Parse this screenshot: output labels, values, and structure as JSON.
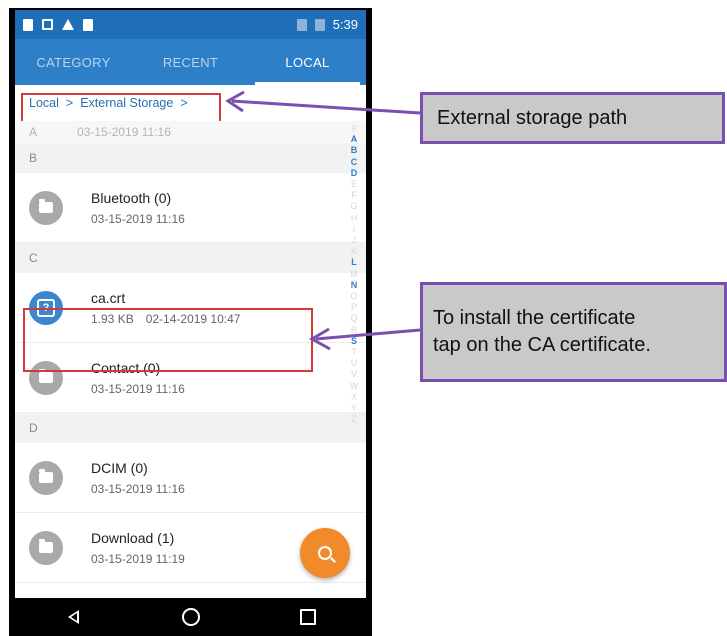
{
  "statusbar": {
    "time": "5:39"
  },
  "tabs": [
    {
      "label": "CATEGORY",
      "active": false
    },
    {
      "label": "RECENT",
      "active": false
    },
    {
      "label": "LOCAL",
      "active": true
    }
  ],
  "breadcrumb": {
    "root": "Local",
    "sep": ">",
    "current": "External Storage",
    "trailing": ">"
  },
  "sections": {
    "a": "A",
    "a_ghost_date": "03-15-2019 11:16",
    "b": "B",
    "c": "C",
    "d": "D"
  },
  "items": {
    "bluetooth": {
      "name": "Bluetooth (0)",
      "date": "03-15-2019 11:16"
    },
    "cacrt": {
      "name": "ca.crt",
      "size": "1.93 KB",
      "date": "02-14-2019 10:47"
    },
    "contact": {
      "name": "Contact (0)",
      "date": "03-15-2019 11:16"
    },
    "dcim": {
      "name": "DCIM (0)",
      "date": "03-15-2019 11:16"
    },
    "download": {
      "name": "Download (1)",
      "date": "03-15-2019 11:19"
    }
  },
  "alpha_index": [
    "#",
    "A",
    "B",
    "C",
    "D",
    "E",
    "F",
    "G",
    "H",
    "I",
    "J",
    "K",
    "L",
    "M",
    "N",
    "O",
    "P",
    "Q",
    "R",
    "S",
    "T",
    "U",
    "V",
    "W",
    "X",
    "Y",
    "Z"
  ],
  "alpha_active": [
    "A",
    "B",
    "C",
    "D",
    "L",
    "N",
    "S"
  ],
  "callouts": {
    "path": "External storage path",
    "install_line1": "To install the certificate",
    "install_line2": "tap on the CA certificate."
  },
  "colors": {
    "accent": "#2d7fc8",
    "highlight": "#d23a3a",
    "callout_border": "#7b4fb0",
    "fab": "#f08a2a"
  }
}
